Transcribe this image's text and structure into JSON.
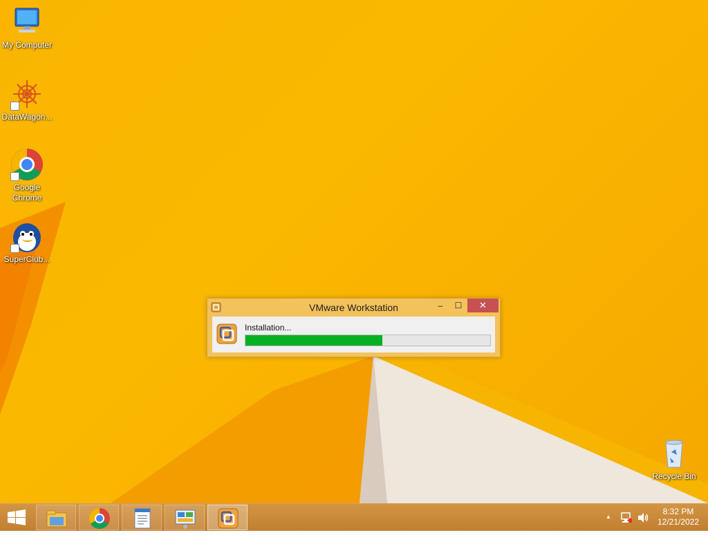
{
  "desktop": {
    "icons": [
      {
        "label": "My Computer",
        "icon": "computer-icon"
      },
      {
        "label": "DataWagon...",
        "icon": "datawagon-icon"
      },
      {
        "label": "Google\nChrome",
        "icon": "chrome-icon"
      },
      {
        "label": "SuperClub...",
        "icon": "penguin-icon"
      },
      {
        "label": "Recycle Bin",
        "icon": "recycle-bin-icon"
      }
    ]
  },
  "dialog": {
    "title": "VMware Workstation",
    "minimize": "‒",
    "maximize": "☐",
    "close": "✕",
    "status": "Installation...",
    "progress": 0.56
  },
  "taskbar": {
    "apps": [
      {
        "name": "File Explorer",
        "icon": "file-explorer-icon"
      },
      {
        "name": "Google Chrome",
        "icon": "chrome-icon"
      },
      {
        "name": "Document",
        "icon": "document-icon"
      },
      {
        "name": "Control Panel",
        "icon": "control-panel-icon"
      },
      {
        "name": "VMware Workstation",
        "icon": "vmware-icon",
        "active": true
      }
    ],
    "tray": {
      "show_hidden": "▲",
      "time": "8:32 PM",
      "date": "12/21/2022"
    }
  },
  "colors": {
    "wallpaper": "#f9b500",
    "taskbar": "#c8873a",
    "progress_fill": "#06b025",
    "close_button": "#c75050"
  }
}
